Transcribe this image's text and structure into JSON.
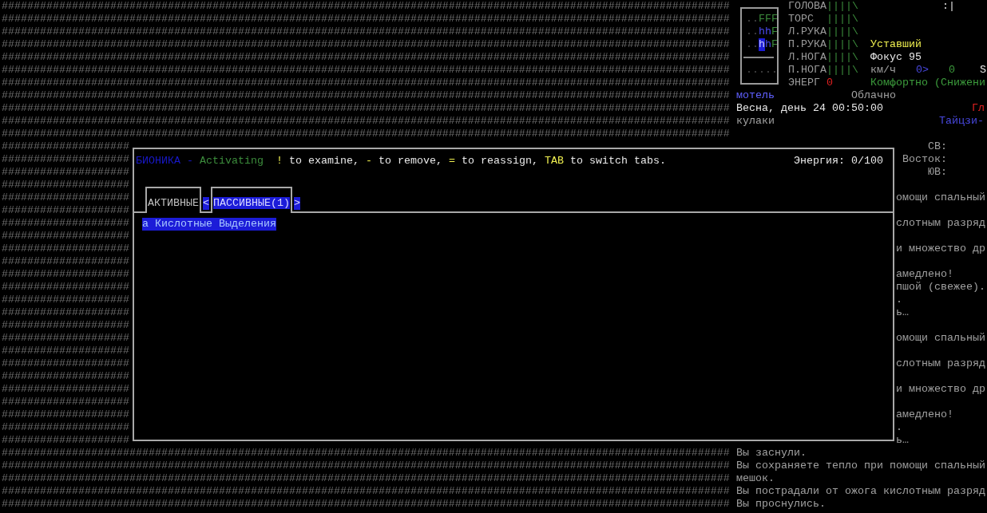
{
  "map": {
    "rows": [
      "##################################################################################################################",
      "##################################################################################################################",
      "##################################################################################################################",
      "##################################################################################################################",
      "##################################################################################################################",
      "##################################################################################################################",
      "##################################################################################################################",
      "##################################################################################################################",
      "##################################################################################################################",
      "##################################################################################################################",
      "##################################################################################################################",
      "####################",
      "####################",
      "####################",
      "####################",
      "####################",
      "####################",
      "####################",
      "####################",
      "####################",
      "####################",
      "####################",
      "####################",
      "####################",
      "####################",
      "####################",
      "####################",
      "####################",
      "####################",
      "####################",
      "####################",
      "####################",
      "####################",
      "####################",
      "####################",
      "##################################################################################################################",
      "##################################################################################################################",
      "##################################################################################################################",
      "##################################################################################################################",
      "##################################################################################################################"
    ]
  },
  "sidebar": {
    "minimap": {
      "upper_rows": [
        [
          {
            "text": "..",
            "kind": "fog"
          },
          {
            "text": "FFF",
            "kind": "forest"
          }
        ],
        [
          {
            "text": "..",
            "kind": "fog"
          },
          {
            "text": "hh",
            "kind": "house"
          },
          {
            "text": "F",
            "kind": "forest"
          }
        ],
        [
          {
            "text": "..",
            "kind": "fog"
          },
          {
            "text": "h",
            "kind": "player"
          },
          {
            "text": "h",
            "kind": "house"
          },
          {
            "text": "F",
            "kind": "forest"
          }
        ]
      ],
      "lower_rows": [
        [
          {
            "text": ".....",
            "kind": "fog"
          }
        ]
      ]
    },
    "body_parts": [
      {
        "name": "ГОЛОВА",
        "bar": "||||\\"
      },
      {
        "name": "ТОРС",
        "bar": "||||\\"
      },
      {
        "name": "Л.РУКА",
        "bar": "||||\\"
      },
      {
        "name": "П.РУКА",
        "bar": "||||\\"
      },
      {
        "name": "Л.НОГА",
        "bar": "||||\\"
      },
      {
        "name": "П.НОГА",
        "bar": "||||\\"
      }
    ],
    "energy": {
      "label": "ЭНЕРГ",
      "value": "0"
    },
    "status": {
      "indicator": ":|",
      "fatigue": "Уставший",
      "focus": "Фокус 95",
      "speed_unit": "км/ч",
      "speed": "0>",
      "column_3": "0",
      "column_4": "S",
      "comfort": "Комфортно (Снижени"
    },
    "location": "мотель",
    "weather": "Облачно",
    "date_time": "Весна, день 24 00:50:00",
    "column_2": "Гл",
    "weapon": "кулаки",
    "style": "Тайцзи-",
    "compass": [
      "СВ:",
      "Восток:",
      "ЮВ:"
    ],
    "log_fragments": [
      [
        "омощи спальный"
      ],
      [
        "слотным разряд"
      ],
      [
        "и множество др"
      ],
      [
        "амедлено!",
        "пшой (свежее).",
        ".",
        "ь…"
      ],
      [
        "омощи спальный"
      ],
      [
        "слотным разряд"
      ],
      [
        "и множество др"
      ],
      [
        "амедлено!",
        ".",
        "ь…"
      ]
    ],
    "messages": [
      "Вы заснули.",
      "Вы сохраняете тепло при помощи спальный",
      "мешок.",
      "Вы пострадали от ожога кислотным разряд",
      "Вы проснулись."
    ]
  },
  "bionics_dialog": {
    "header": [
      {
        "text": "БИОНИКА",
        "kind": "title"
      },
      {
        "text": "-",
        "kind": "title"
      },
      {
        "text": "Activating ",
        "kind": "mode"
      },
      {
        "text": "!",
        "kind": "key"
      },
      {
        "text": "to examine,",
        "kind": "hint"
      },
      {
        "text": "-",
        "kind": "key"
      },
      {
        "text": "to remove,",
        "kind": "hint"
      },
      {
        "text": "=",
        "kind": "key"
      },
      {
        "text": "to reassign,",
        "kind": "hint"
      },
      {
        "text": "TAB",
        "kind": "key"
      },
      {
        "text": "to switch tabs.",
        "kind": "hint"
      }
    ],
    "power": "Энергия: 0/100",
    "tabs": [
      {
        "label": "АКТИВНЫЕ",
        "selected": false
      },
      {
        "label": "ПАССИВНЫЕ(1)",
        "selected": true
      }
    ],
    "tab_arrows": {
      "left": "<",
      "right": ">"
    },
    "items": [
      {
        "key": "a",
        "name": "Кислотные Выделения",
        "selected": true
      }
    ]
  }
}
